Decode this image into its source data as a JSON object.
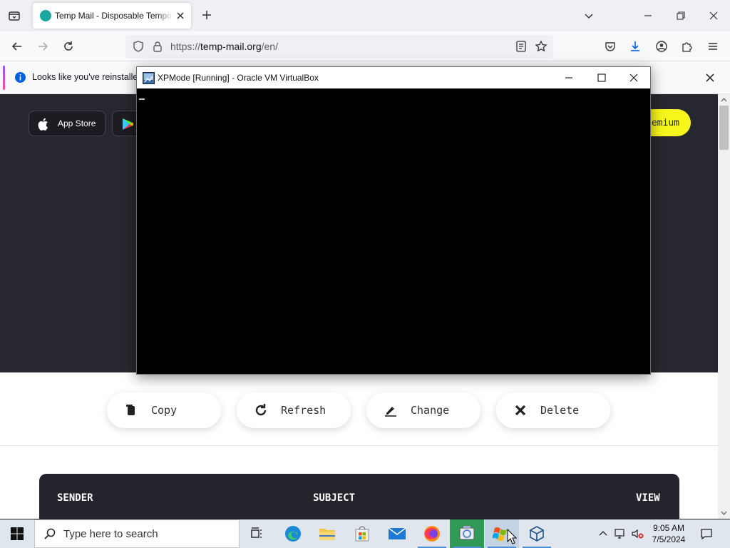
{
  "browser": {
    "tab": {
      "title": "Temp Mail - Disposable Temporary Email"
    },
    "url": {
      "prefix": "https://",
      "host": "temp-mail.org",
      "path": "/en/"
    },
    "notification": {
      "text": "Looks like you've reinstalled"
    }
  },
  "page": {
    "store_buttons": [
      {
        "label": "App Store"
      }
    ],
    "premium_label": "emium",
    "actions": [
      {
        "label": "Copy"
      },
      {
        "label": "Refresh"
      },
      {
        "label": "Change"
      },
      {
        "label": "Delete"
      }
    ],
    "inbox_headers": {
      "sender": "SENDER",
      "subject": "SUBJECT",
      "view": "VIEW"
    }
  },
  "virtualbox": {
    "title": "XPMode [Running] - Oracle VM VirtualBox"
  },
  "taskbar": {
    "search_placeholder": "Type here to search",
    "clock": {
      "time": "9:05 AM",
      "date": "7/5/2024"
    }
  },
  "colors": {
    "premium": "#f6f61b",
    "hero_bg": "#27272f",
    "accent_link": "#0060df"
  }
}
